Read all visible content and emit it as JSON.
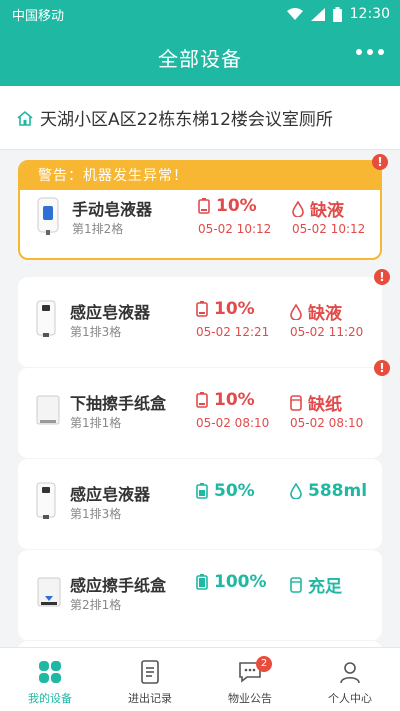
{
  "status_bar": {
    "carrier": "中国移动",
    "time": "12:30"
  },
  "header": {
    "title": "全部设备",
    "more_icon": "more-dots-icon"
  },
  "location": {
    "icon": "home-icon",
    "text": "天湖小区A区22栋东梯12楼会议室厕所"
  },
  "alert_text": "警告：机器发生异常！",
  "devices": [
    {
      "name": "手动皂液器",
      "position": "第1排2格",
      "icon": "manual-soap-dispenser",
      "level": "10%",
      "level_time": "05-02 10:12",
      "supply": "缺液",
      "supply_time": "05-02 10:12",
      "status": "alert"
    },
    {
      "name": "感应皂液器",
      "position": "第1排3格",
      "icon": "sensor-soap-dispenser",
      "level": "10%",
      "level_time": "05-02 12:21",
      "supply": "缺液",
      "supply_time": "05-02 11:20",
      "status": "warning"
    },
    {
      "name": "下抽擦手纸盒",
      "position": "第1排1格",
      "icon": "paper-towel-box",
      "level": "10%",
      "level_time": "05-02 08:10",
      "supply": "缺纸",
      "supply_time": "05-02 08:10",
      "status": "warning"
    },
    {
      "name": "感应皂液器",
      "position": "第1排3格",
      "icon": "sensor-soap-dispenser",
      "level": "50%",
      "supply": "588ml",
      "status": "ok"
    },
    {
      "name": "感应擦手纸盒",
      "position": "第2排1格",
      "icon": "sensor-towel-box",
      "level": "100%",
      "supply": "充足",
      "status": "ok"
    }
  ],
  "colors": {
    "primary": "#1fb8a3",
    "alert": "#f7b733",
    "danger": "#e14b4b"
  },
  "tabs": [
    {
      "label": "我的设备",
      "icon": "grid-icon",
      "active": true
    },
    {
      "label": "进出记录",
      "icon": "document-icon"
    },
    {
      "label": "物业公告",
      "icon": "chat-icon",
      "badge": "2"
    },
    {
      "label": "个人中心",
      "icon": "user-icon"
    }
  ]
}
